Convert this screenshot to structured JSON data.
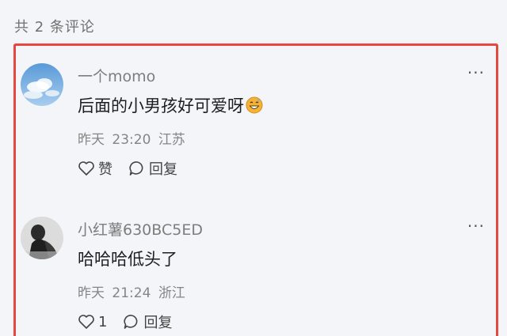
{
  "header": {
    "count_text": "共 2 条评论"
  },
  "comments": [
    {
      "username": "一个momo",
      "content": "后面的小男孩好可爱呀",
      "emoji": "grinning-face-with-sweat-icon",
      "date": "昨天",
      "time": "23:20",
      "location": "江苏",
      "like_label": "赞",
      "reply_label": "回复",
      "avatar": "sky-clouds-avatar"
    },
    {
      "username": "小红薯630BC5ED",
      "content": "哈哈哈低头了",
      "date": "昨天",
      "time": "21:24",
      "location": "浙江",
      "like_label": "1",
      "reply_label": "回复",
      "avatar": "person-photo-avatar"
    }
  ],
  "colors": {
    "highlight_border": "#e8473f",
    "background": "#f4f5f9"
  }
}
